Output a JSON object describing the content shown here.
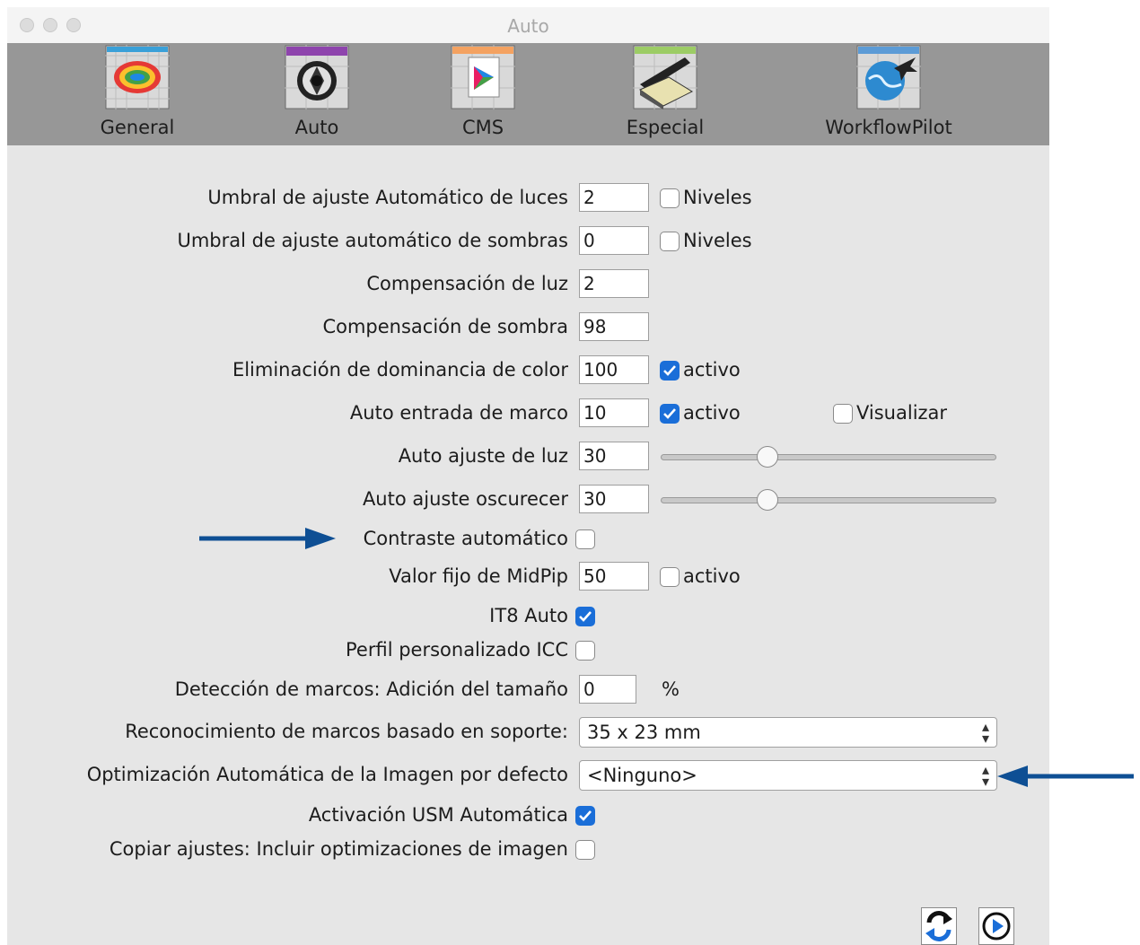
{
  "window": {
    "title": "Auto"
  },
  "toolbar": {
    "items": [
      {
        "label": "General",
        "icon": "general-panel-icon"
      },
      {
        "label": "Auto",
        "icon": "auto-aperture-icon"
      },
      {
        "label": "CMS",
        "icon": "cms-color-icon"
      },
      {
        "label": "Especial",
        "icon": "scanner-icon"
      },
      {
        "label": "WorkflowPilot",
        "icon": "workflowpilot-plane-icon"
      }
    ]
  },
  "settings": {
    "highlight_threshold": {
      "label": "Umbral de ajuste Automático de luces",
      "value": "2",
      "check_label": "Niveles",
      "checked": false
    },
    "shadow_threshold": {
      "label": "Umbral de ajuste automático de sombras",
      "value": "0",
      "check_label": "Niveles",
      "checked": false
    },
    "light_compensation": {
      "label": "Compensación de luz",
      "value": "2"
    },
    "shadow_compensation": {
      "label": "Compensación de sombra",
      "value": "98"
    },
    "color_cast_removal": {
      "label": "Eliminación de dominancia de color",
      "value": "100",
      "check_label": "activo",
      "checked": true
    },
    "auto_frame_inset": {
      "label": "Auto entrada de marco",
      "value": "10",
      "check_label": "activo",
      "checked": true,
      "check2_label": "Visualizar",
      "checked2": false
    },
    "auto_light_adjust": {
      "label": "Auto ajuste de luz",
      "value": "30",
      "slider_fraction": 0.3
    },
    "auto_darken_adjust": {
      "label": "Auto ajuste oscurecer",
      "value": "30",
      "slider_fraction": 0.3
    },
    "auto_contrast": {
      "label": "Contraste automático",
      "checked": false
    },
    "midpip_value": {
      "label": "Valor fijo de MidPip",
      "value": "50",
      "check_label": "activo",
      "checked": false
    },
    "it8_auto": {
      "label": "IT8 Auto",
      "checked": true
    },
    "icc_profile": {
      "label": "Perfil personalizado ICC",
      "checked": false
    },
    "frame_detection": {
      "label": "Detección de marcos: Adición del tamaño",
      "value": "0",
      "unit": "%"
    },
    "frame_recognition": {
      "label": "Reconocimiento de marcos basado en soporte:",
      "selected": "35 x 23 mm"
    },
    "auto_optimization": {
      "label": "Optimización Automática de la Imagen por defecto",
      "selected": "<Ninguno>"
    },
    "usm_activation": {
      "label": "Activación USM Automática",
      "checked": true
    },
    "copy_settings": {
      "label": "Copiar ajustes: Incluir optimizaciones de imagen",
      "checked": false
    }
  },
  "colors": {
    "accent": "#1a6ed8",
    "annotation_arrow": "#0e4f94",
    "toolbar_bg": "#979797",
    "panel_bg": "#e6e6e6"
  },
  "bottom_buttons": [
    {
      "icon": "refresh-icon"
    },
    {
      "icon": "play-icon"
    }
  ]
}
